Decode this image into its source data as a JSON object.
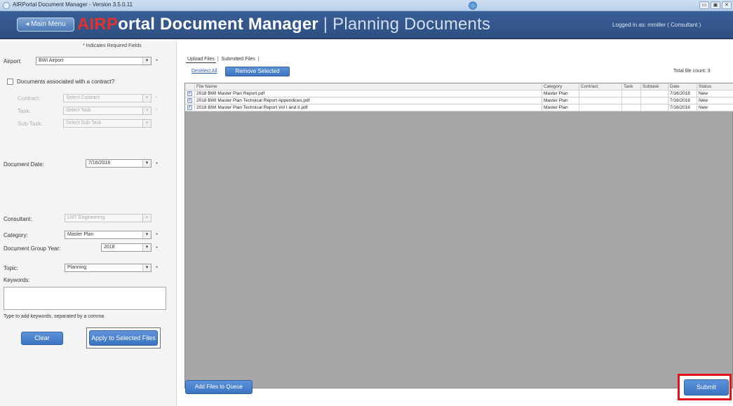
{
  "window": {
    "title": "AIRPortal Document Manager - Version 3.5.0.11",
    "buttons": [
      "▭",
      "▣",
      "✕"
    ]
  },
  "header": {
    "main_menu": "◂ Main Menu",
    "brand_prefix": "AIRP",
    "brand_rest": "ortal Document Manager",
    "brand_sep": "|",
    "section": "Planning Documents",
    "logged_in": "Logged in as: mmiller ( Consultant )"
  },
  "form": {
    "required_note": "* Indicates Required Fields",
    "airport_label": "Airport:",
    "airport_value": "BWI Airport",
    "contract_checkbox_label": "Documents associated with a contract?",
    "contract_label": "Contract:",
    "contract_value": "Select Contract",
    "task_label": "Task:",
    "task_value": "Select Task",
    "subtask_label": "Sub-Task:",
    "subtask_value": "Select Sub-Task",
    "doc_date_label": "Document Date:",
    "doc_date_value": "7/16/2018",
    "consultant_label": "Consultant:",
    "consultant_value": "LMT Engineering",
    "category_label": "Category:",
    "category_value": "Master Plan",
    "group_year_label": "Document Group Year:",
    "group_year_value": "2018",
    "topic_label": "Topic:",
    "topic_value": "Planning",
    "keywords_label": "Keywords:",
    "keywords_value": "",
    "keywords_hint": "Type to add keywords, separated by a comma",
    "clear_button": "Clear",
    "apply_button": "Apply to Selected Files",
    "star": "*",
    "arrow": "▾"
  },
  "files": {
    "tab_upload": "Upload Files",
    "tab_submitted": "Submitted Files",
    "tab_sep": "|",
    "deselect_all": "Deselect All",
    "remove_selected": "Remove Selected",
    "total_count": "Total file count: 3",
    "columns": [
      "File Name",
      "Category",
      "Contract",
      "Task",
      "Subtask",
      "Date",
      "Status"
    ],
    "rows": [
      {
        "name": "2018 BWI Master Plan Report.pdf",
        "category": "Master Plan",
        "contract": "",
        "task": "",
        "subtask": "",
        "date": "7/16/2018",
        "status": "New",
        "checked": true
      },
      {
        "name": "2018 BWI Master Plan Technical Report Appendices.pdf",
        "category": "Master Plan",
        "contract": "",
        "task": "",
        "subtask": "",
        "date": "7/16/2018",
        "status": "New",
        "checked": true
      },
      {
        "name": "2018 BWI Master Plan Technical Report Vol I and II.pdf",
        "category": "Master Plan",
        "contract": "",
        "task": "",
        "subtask": "",
        "date": "7/16/2018",
        "status": "New",
        "checked": true
      }
    ],
    "add_button": "Add Files to Queue",
    "submit_button": "Submit"
  },
  "colors": {
    "header_bg": "#2d4f83",
    "brand_accent": "#e2322c",
    "button_blue": "#3b74c2",
    "highlight_red": "#e3131b"
  }
}
